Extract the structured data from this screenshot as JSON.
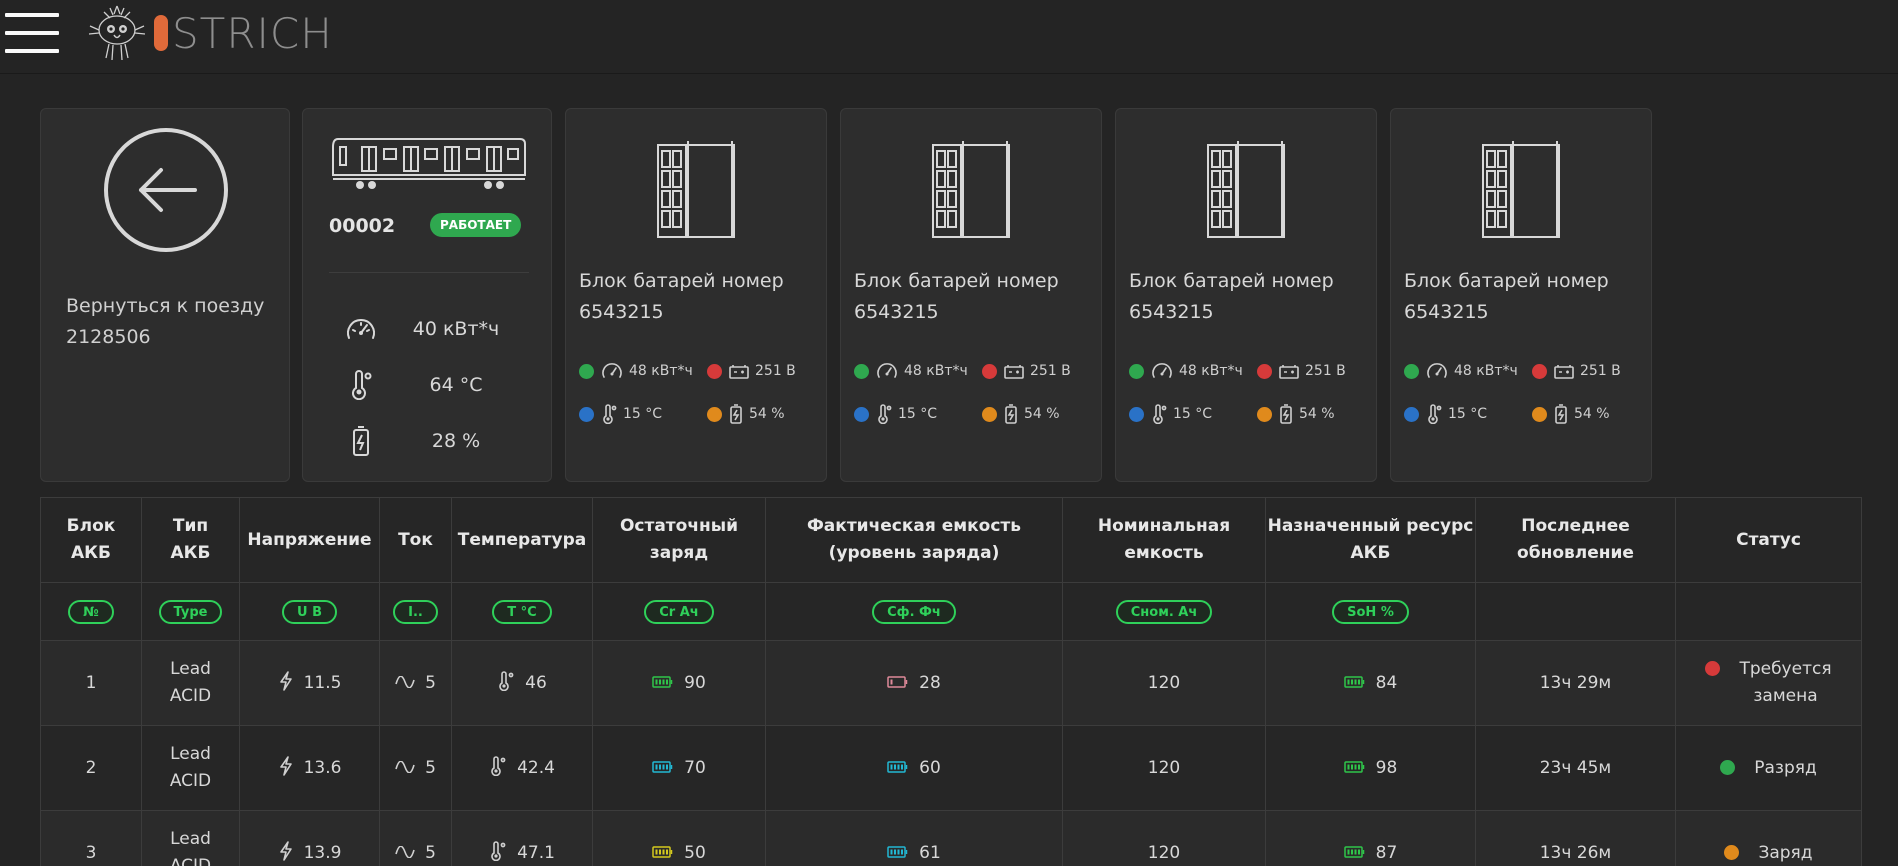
{
  "header": {
    "logo_text": "STRICH"
  },
  "back": {
    "label_line1": "Вернуться к поезду",
    "label_line2": "2128506"
  },
  "train": {
    "number": "00002",
    "status": "РАБОТАЕТ",
    "energy": "40 кВт*ч",
    "temperature": "64 °C",
    "charge": "28 %"
  },
  "battery_blocks": [
    {
      "title_line1": "Блок батарей номер",
      "title_line2": "6543215",
      "energy": "48 кВт*ч",
      "voltage": "251 В",
      "temperature": "15 °C",
      "charge": "54 %"
    },
    {
      "title_line1": "Блок батарей номер",
      "title_line2": "6543215",
      "energy": "48 кВт*ч",
      "voltage": "251 В",
      "temperature": "15 °C",
      "charge": "54 %"
    },
    {
      "title_line1": "Блок батарей номер",
      "title_line2": "6543215",
      "energy": "48 кВт*ч",
      "voltage": "251 В",
      "temperature": "15 °C",
      "charge": "54 %"
    },
    {
      "title_line1": "Блок батарей номер",
      "title_line2": "6543215",
      "energy": "48 кВт*ч",
      "voltage": "251 В",
      "temperature": "15 °C",
      "charge": "54 %"
    }
  ],
  "table": {
    "headers": [
      {
        "l1": "Блок",
        "l2": "АКБ"
      },
      {
        "l1": "Тип",
        "l2": "АКБ"
      },
      {
        "l1": "Напряжение",
        "l2": ""
      },
      {
        "l1": "Ток",
        "l2": ""
      },
      {
        "l1": "Температура",
        "l2": ""
      },
      {
        "l1": "Остаточный",
        "l2": "заряд"
      },
      {
        "l1": "Фактическая емкость",
        "l2": "(уровень заряда)"
      },
      {
        "l1": "Номинальная",
        "l2": "емкость"
      },
      {
        "l1": "Назначенный ресурс",
        "l2": "АКБ"
      },
      {
        "l1": "Последнее",
        "l2": "обновление"
      },
      {
        "l1": "Статус",
        "l2": ""
      }
    ],
    "units": [
      "№",
      "Type",
      "U В",
      "I..",
      "T °C",
      "Cr Ач",
      "Сф. Фч",
      "Сном. Ач",
      "SoH %",
      "",
      ""
    ],
    "rows": [
      {
        "block": "1",
        "type_l1": "Lead",
        "type_l2": "ACID",
        "voltage": "11.5",
        "current": "5",
        "temp": "46",
        "residual": "90",
        "residual_color": "#2fc64a",
        "actual": "28",
        "actual_color": "#e08a9a",
        "nominal": "120",
        "soh": "84",
        "soh_color": "#2fc64a",
        "updated": "13ч 29м",
        "status_l1": "Требуется",
        "status_l2": "замена",
        "status_color": "#d63a3a"
      },
      {
        "block": "2",
        "type_l1": "Lead",
        "type_l2": "ACID",
        "voltage": "13.6",
        "current": "5",
        "temp": "42.4",
        "residual": "70",
        "residual_color": "#22b8d4",
        "actual": "60",
        "actual_color": "#22b8d4",
        "nominal": "120",
        "soh": "98",
        "soh_color": "#2fc64a",
        "updated": "23ч 45м",
        "status_l1": "Разряд",
        "status_l2": "",
        "status_color": "#2fa84f"
      },
      {
        "block": "3",
        "type_l1": "Lead",
        "type_l2": "ACID",
        "voltage": "13.9",
        "current": "5",
        "temp": "47.1",
        "residual": "50",
        "residual_color": "#d4c91e",
        "actual": "61",
        "actual_color": "#22b8d4",
        "nominal": "120",
        "soh": "87",
        "soh_color": "#2fc64a",
        "updated": "13ч 26м",
        "status_l1": "Заряд",
        "status_l2": "",
        "status_color": "#e08a1c"
      }
    ]
  }
}
